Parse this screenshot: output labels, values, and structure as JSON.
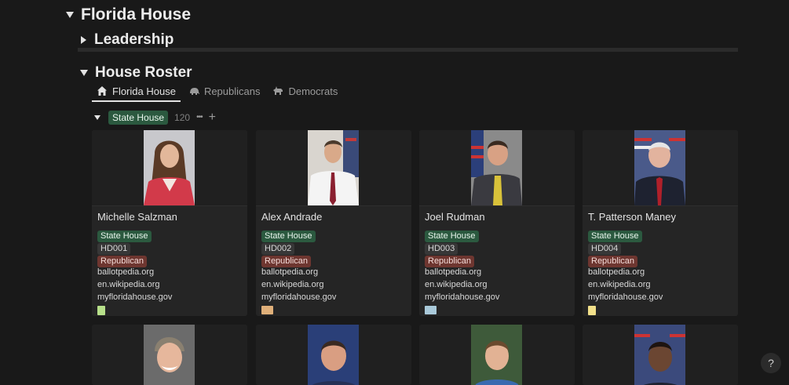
{
  "page": {
    "title": "Florida House",
    "sections": {
      "leadership": "Leadership",
      "roster": "House Roster"
    }
  },
  "tabs": [
    {
      "label": "Florida House",
      "icon": "home-icon"
    },
    {
      "label": "Republicans",
      "icon": "elephant-icon"
    },
    {
      "label": "Democrats",
      "icon": "donkey-icon"
    }
  ],
  "group": {
    "label": "State House",
    "count": "120",
    "more": "•••",
    "add": "+"
  },
  "cards": [
    {
      "name": "Michelle Salzman",
      "chamber": "State House",
      "district": "HD001",
      "party": "Republican",
      "links": [
        "ballotpedia.org",
        "en.wikipedia.org",
        "myfloridahouse.gov"
      ],
      "thumb_color": "#b7e08a"
    },
    {
      "name": "Alex Andrade",
      "chamber": "State House",
      "district": "HD002",
      "party": "Republican",
      "links": [
        "ballotpedia.org",
        "en.wikipedia.org",
        "myfloridahouse.gov"
      ],
      "thumb_color": "#e0b07a"
    },
    {
      "name": "Joel Rudman",
      "chamber": "State House",
      "district": "HD003",
      "party": "Republican",
      "links": [
        "ballotpedia.org",
        "en.wikipedia.org",
        "myfloridahouse.gov"
      ],
      "thumb_color": "#a9c9d9"
    },
    {
      "name": "T. Patterson Maney",
      "chamber": "State House",
      "district": "HD004",
      "party": "Republican",
      "links": [
        "ballotpedia.org",
        "en.wikipedia.org",
        "myfloridahouse.gov"
      ],
      "thumb_color": "#f2e08a"
    }
  ],
  "colors": {
    "background": "#191919",
    "card": "#252525",
    "green_tag": "#2b593f",
    "red_tag": "#6e3630",
    "gray_tag": "#373737"
  },
  "help": "?"
}
